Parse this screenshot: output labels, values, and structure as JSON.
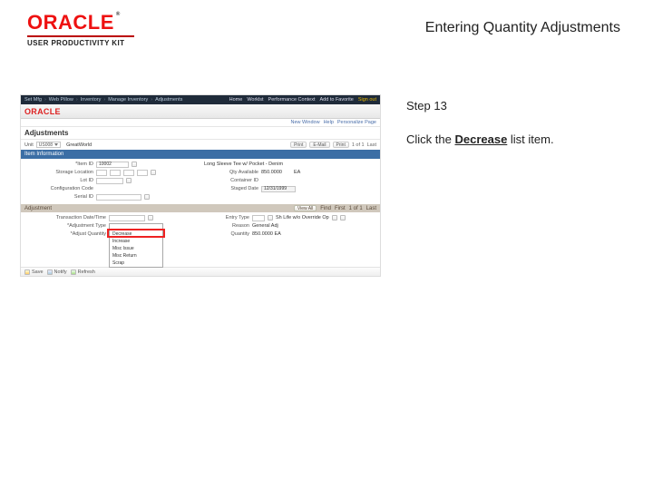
{
  "logo": {
    "brand": "ORACLE",
    "tm": "®",
    "subline": "USER PRODUCTIVITY KIT"
  },
  "page_title": "Entering Quantity Adjustments",
  "instruction": {
    "step_label": "Step 13",
    "line_pre": "Click the ",
    "keyword": "Decrease",
    "line_post": " list item."
  },
  "shot": {
    "topbar": {
      "crumbs": [
        "Set Mfg",
        "Web Pillow",
        "Inventory",
        "Manage Inventory",
        "Adjustments"
      ],
      "right": [
        "Home",
        "Worklst",
        "Performance Context",
        "Add to Favorite"
      ],
      "signout": "Sign out"
    },
    "brand": "ORACLE",
    "subbar": {
      "left": "New Window",
      "mid": "Help",
      "right": "Personalize Page"
    },
    "title": "Adjustments",
    "toolbar": {
      "unit_label": "Unit",
      "unit_value": "US008",
      "search": "GreatWorld",
      "actions": [
        "Print",
        "E-Mail",
        "Print",
        "1 of 1",
        "Last"
      ]
    },
    "band_blue": "Item Information",
    "form_left": [
      {
        "label": "*Item ID",
        "value": "10002",
        "field": true
      },
      {
        "label": "Storage Location",
        "value": "",
        "field": true,
        "icon": true
      },
      {
        "label": "Lot ID",
        "value": "",
        "field": true,
        "icon": true
      },
      {
        "label": "Configuration Code",
        "value": "",
        "field": false
      },
      {
        "label": "Serial ID",
        "value": "",
        "field": true,
        "icon": true
      }
    ],
    "form_right": [
      {
        "label": "",
        "value": "Long Sleeve Tee w/ Pocket - Denim"
      },
      {
        "label": "Qty Available",
        "value": "850.0000"
      },
      {
        "label": "Container ID",
        "value": ""
      },
      {
        "label": "Staged Date",
        "value": "12/31/1999"
      }
    ],
    "uom": "EA",
    "band_grey": "Adjustment",
    "grey_right": {
      "view": "View All",
      "find": "Find",
      "first": "First",
      "nav": "1 of 1",
      "last": "Last"
    },
    "sub_left": [
      {
        "label": "Transaction Date/Time",
        "value": "",
        "icon": true
      },
      {
        "label": "*Adjustment Type",
        "value": ""
      },
      {
        "label": "*Adjust Quantity",
        "value": ""
      }
    ],
    "sub_right": [
      {
        "label": "Entry Type",
        "value": "Sh Life w/o Override Op",
        "icon": true
      },
      {
        "label": "Reason",
        "value": "General Adj"
      },
      {
        "label": "Quantity",
        "value": "850.0000  EA"
      }
    ],
    "combo_options": [
      "Decrease",
      "Increase",
      "Misc Issue",
      "Misc Return",
      "Scrap"
    ],
    "footer": [
      "Save",
      "Notify",
      "Refresh"
    ]
  }
}
